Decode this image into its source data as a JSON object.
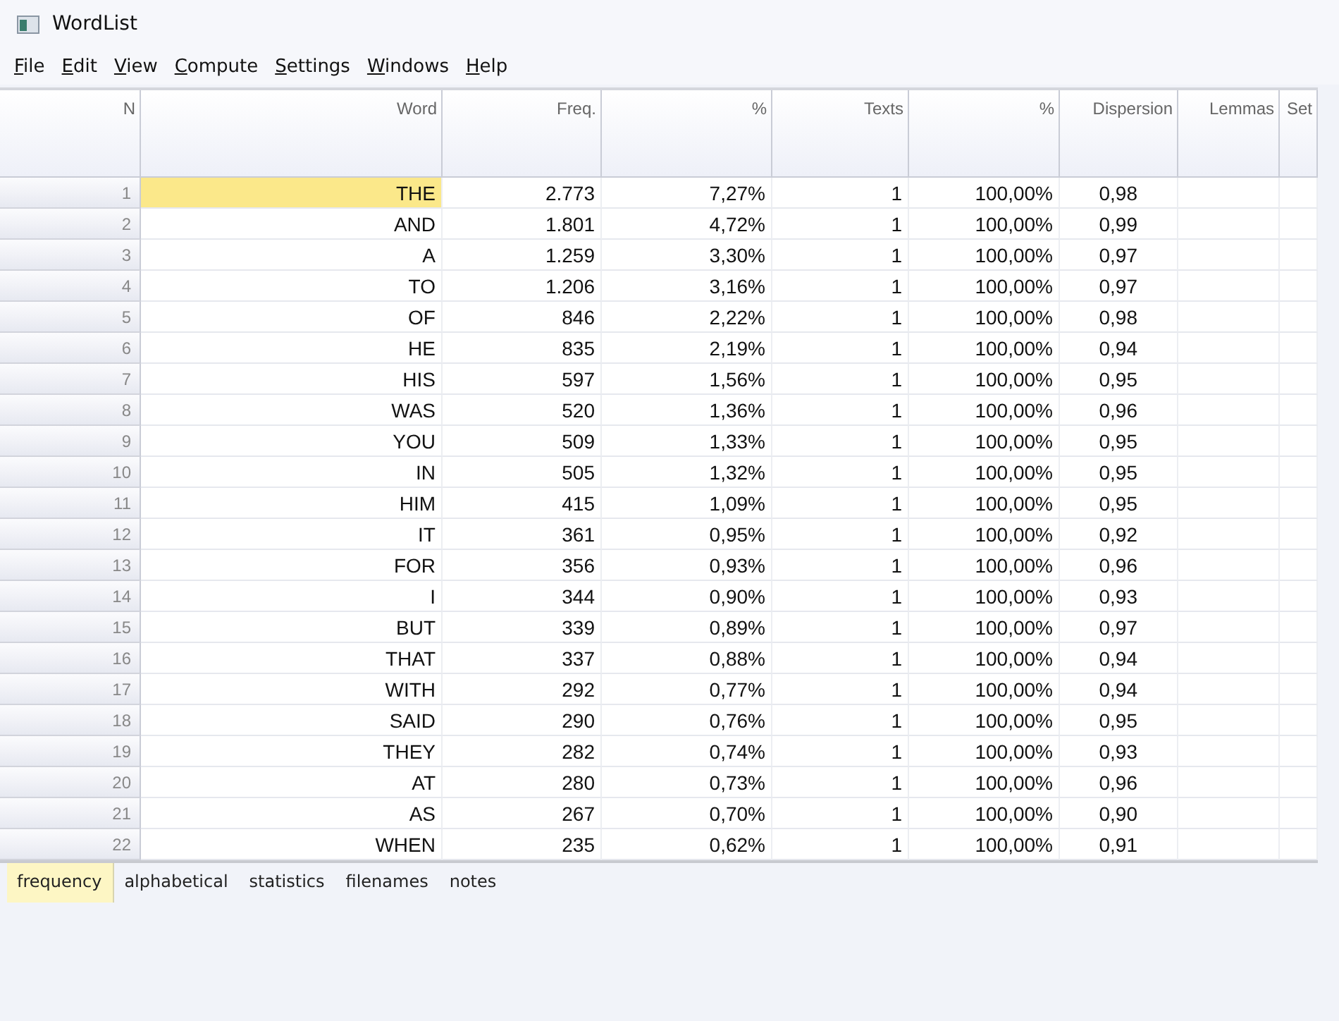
{
  "window": {
    "title": "WordList"
  },
  "menu": [
    "File",
    "Edit",
    "View",
    "Compute",
    "Settings",
    "Windows",
    "Help"
  ],
  "table": {
    "columns": [
      "N",
      "Word",
      "Freq.",
      "%",
      "Texts",
      "%",
      "Dispersion",
      "Lemmas",
      "Set"
    ],
    "rows": [
      {
        "cells": [
          "1",
          "THE",
          "2.773",
          "7,27%",
          "1",
          "100,00%",
          "0,98"
        ],
        "selected": true
      },
      {
        "cells": [
          "2",
          "AND",
          "1.801",
          "4,72%",
          "1",
          "100,00%",
          "0,99"
        ],
        "selected": false
      },
      {
        "cells": [
          "3",
          "A",
          "1.259",
          "3,30%",
          "1",
          "100,00%",
          "0,97"
        ],
        "selected": false
      },
      {
        "cells": [
          "4",
          "TO",
          "1.206",
          "3,16%",
          "1",
          "100,00%",
          "0,97"
        ],
        "selected": false
      },
      {
        "cells": [
          "5",
          "OF",
          "846",
          "2,22%",
          "1",
          "100,00%",
          "0,98"
        ],
        "selected": false
      },
      {
        "cells": [
          "6",
          "HE",
          "835",
          "2,19%",
          "1",
          "100,00%",
          "0,94"
        ],
        "selected": false
      },
      {
        "cells": [
          "7",
          "HIS",
          "597",
          "1,56%",
          "1",
          "100,00%",
          "0,95"
        ],
        "selected": false
      },
      {
        "cells": [
          "8",
          "WAS",
          "520",
          "1,36%",
          "1",
          "100,00%",
          "0,96"
        ],
        "selected": false
      },
      {
        "cells": [
          "9",
          "YOU",
          "509",
          "1,33%",
          "1",
          "100,00%",
          "0,95"
        ],
        "selected": false
      },
      {
        "cells": [
          "10",
          "IN",
          "505",
          "1,32%",
          "1",
          "100,00%",
          "0,95"
        ],
        "selected": false
      },
      {
        "cells": [
          "11",
          "HIM",
          "415",
          "1,09%",
          "1",
          "100,00%",
          "0,95"
        ],
        "selected": false
      },
      {
        "cells": [
          "12",
          "IT",
          "361",
          "0,95%",
          "1",
          "100,00%",
          "0,92"
        ],
        "selected": false
      },
      {
        "cells": [
          "13",
          "FOR",
          "356",
          "0,93%",
          "1",
          "100,00%",
          "0,96"
        ],
        "selected": false
      },
      {
        "cells": [
          "14",
          "I",
          "344",
          "0,90%",
          "1",
          "100,00%",
          "0,93"
        ],
        "selected": false
      },
      {
        "cells": [
          "15",
          "BUT",
          "339",
          "0,89%",
          "1",
          "100,00%",
          "0,97"
        ],
        "selected": false
      },
      {
        "cells": [
          "16",
          "THAT",
          "337",
          "0,88%",
          "1",
          "100,00%",
          "0,94"
        ],
        "selected": false
      },
      {
        "cells": [
          "17",
          "WITH",
          "292",
          "0,77%",
          "1",
          "100,00%",
          "0,94"
        ],
        "selected": false
      },
      {
        "cells": [
          "18",
          "SAID",
          "290",
          "0,76%",
          "1",
          "100,00%",
          "0,95"
        ],
        "selected": false
      },
      {
        "cells": [
          "19",
          "THEY",
          "282",
          "0,74%",
          "1",
          "100,00%",
          "0,93"
        ],
        "selected": false
      },
      {
        "cells": [
          "20",
          "AT",
          "280",
          "0,73%",
          "1",
          "100,00%",
          "0,96"
        ],
        "selected": false
      },
      {
        "cells": [
          "21",
          "AS",
          "267",
          "0,70%",
          "1",
          "100,00%",
          "0,90"
        ],
        "selected": false
      },
      {
        "cells": [
          "22",
          "WHEN",
          "235",
          "0,62%",
          "1",
          "100,00%",
          "0,91"
        ],
        "selected": false
      }
    ]
  },
  "tabs": [
    {
      "label": "frequency",
      "selected": true
    },
    {
      "label": "alphabetical",
      "selected": false
    },
    {
      "label": "statistics",
      "selected": false
    },
    {
      "label": "filenames",
      "selected": false
    },
    {
      "label": "notes",
      "selected": false
    }
  ]
}
